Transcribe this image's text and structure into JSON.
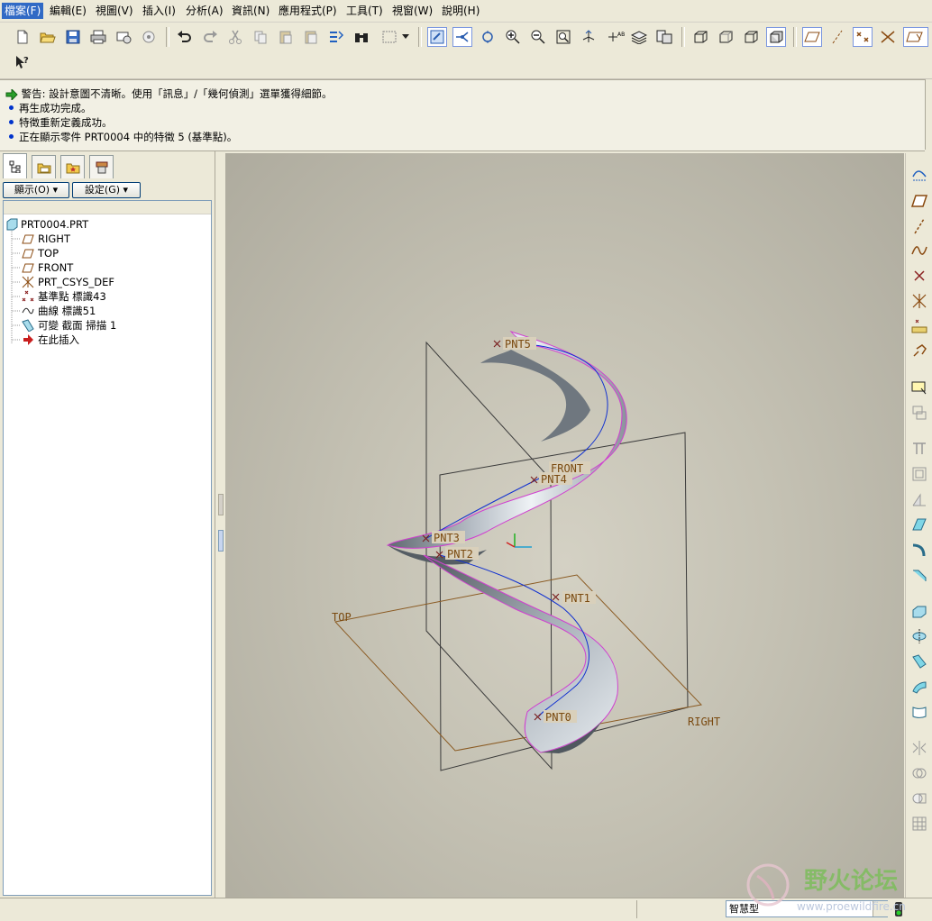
{
  "menu": [
    "檔案(F)",
    "編輯(E)",
    "視圖(V)",
    "插入(I)",
    "分析(A)",
    "資訊(N)",
    "應用程式(P)",
    "工具(T)",
    "視窗(W)",
    "說明(H)"
  ],
  "messages": [
    {
      "type": "warning",
      "text": "警告: 設計意圖不清晰。使用「訊息」/「幾何偵測」選單獲得細節。"
    },
    {
      "type": "info",
      "text": "再生成功完成。"
    },
    {
      "type": "info",
      "text": "特徵重新定義成功。"
    },
    {
      "type": "info",
      "text": "正在顯示零件 PRT0004 中的特徵 5 (基準點)。"
    }
  ],
  "panel": {
    "show_label": "顯示(O)",
    "settings_label": "設定(G)"
  },
  "tree": [
    {
      "label": "PRT0004.PRT",
      "icon": "part-icon"
    },
    {
      "label": "RIGHT",
      "icon": "datum-plane-icon"
    },
    {
      "label": "TOP",
      "icon": "datum-plane-icon"
    },
    {
      "label": "FRONT",
      "icon": "datum-plane-icon"
    },
    {
      "label": "PRT_CSYS_DEF",
      "icon": "csys-icon"
    },
    {
      "label": "基準點 標識43",
      "icon": "datum-point-icon"
    },
    {
      "label": "曲線 標識51",
      "icon": "curve-icon"
    },
    {
      "label": "可變 截面 掃描 1",
      "icon": "sweep-icon"
    },
    {
      "label": "在此插入",
      "icon": "insert-here-icon"
    }
  ],
  "model_labels": {
    "planes": [
      "FRONT",
      "TOP",
      "RIGHT"
    ],
    "points": [
      "PNT0",
      "PNT1",
      "PNT2",
      "PNT3",
      "PNT4",
      "PNT5"
    ]
  },
  "status": {
    "filter": "智慧型"
  },
  "watermark": {
    "title": "野火论坛",
    "url": "www.proewildfire.cn"
  }
}
